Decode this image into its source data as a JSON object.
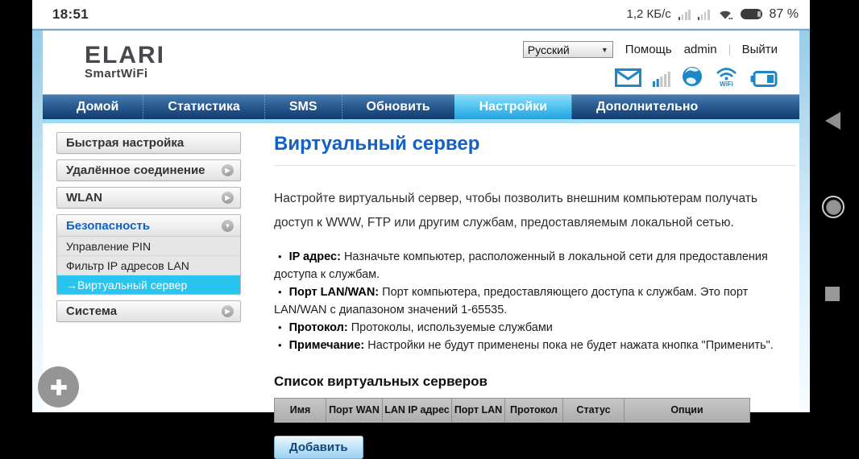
{
  "status_bar": {
    "time": "18:51",
    "net_speed": "1,2 КБ/с",
    "battery_percent": "87 %"
  },
  "header": {
    "logo_line1": "ELARI",
    "logo_line2": "SmartWiFi",
    "language_selected": "Русский",
    "help_label": "Помощь",
    "user_label": "admin",
    "logout_label": "Выйти"
  },
  "nav": {
    "items": [
      {
        "label": "Домой"
      },
      {
        "label": "Статистика"
      },
      {
        "label": "SMS"
      },
      {
        "label": "Обновить"
      },
      {
        "label": "Настройки"
      },
      {
        "label": "Дополнительно"
      }
    ],
    "active_index": 4
  },
  "sidebar": {
    "items": [
      {
        "label": "Быстрая настройка",
        "arrow": "none"
      },
      {
        "label": "Удалённое соединение",
        "arrow": "right"
      },
      {
        "label": "WLAN",
        "arrow": "right"
      },
      {
        "label": "Безопасность",
        "arrow": "down",
        "children": [
          "Управление PIN",
          "Фильтр IP адресов LAN",
          "→Виртуальный сервер"
        ],
        "active_child_index": 2
      },
      {
        "label": "Система",
        "arrow": "right"
      }
    ]
  },
  "main": {
    "title": "Виртуальный сервер",
    "intro": "Настройте виртуальный сервер, чтобы позволить внешним компьютерам получать доступ к WWW, FTP или другим службам, предоставляемым локальной сетью.",
    "bullets": [
      {
        "label": "IP адрес:",
        "text": " Назначьте компьютер, расположенный в локальной сети для предоставления доступа к службам."
      },
      {
        "label": "Порт LAN/WAN:",
        "text": " Порт компьютера, предоставляющего доступа к службам. Это порт LAN/WAN с диапазоном значений 1-65535."
      },
      {
        "label": "Протокол:",
        "text": " Протоколы, используемые службами"
      },
      {
        "label": "Примечание:",
        "text": " Настройки не будут применены пока не будет нажата кнопка \"Применить\"."
      }
    ],
    "table_title": "Список виртуальных серверов",
    "table": {
      "headers": [
        "Имя",
        "Порт WAN",
        "LAN IP адрес",
        "Порт LAN",
        "Протокол",
        "Статус",
        "Опции"
      ],
      "rows": []
    },
    "add_button_label": "Добавить"
  },
  "colors": {
    "accent_blue": "#1261c4",
    "nav_dark_blue": "#113c70",
    "active_tab_cyan": "#29a9e4",
    "sidebar_active_cyan": "#29c4f0",
    "icon_blue": "#1e88c7"
  }
}
